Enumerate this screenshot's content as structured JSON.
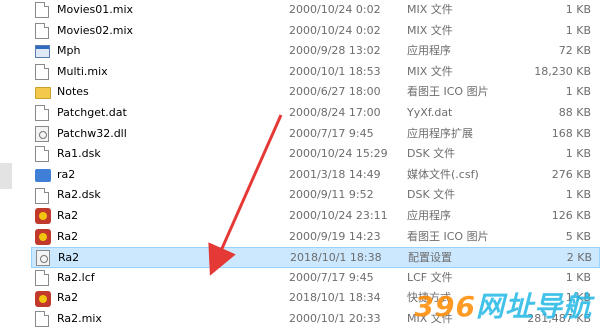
{
  "files": [
    {
      "name": "Movies01.mix",
      "date": "2000/10/24 0:02",
      "type": "MIX 文件",
      "size": "1 KB",
      "icon": "doc-icon",
      "selected": false
    },
    {
      "name": "Movies02.mix",
      "date": "2000/10/24 0:02",
      "type": "MIX 文件",
      "size": "1 KB",
      "icon": "doc-icon",
      "selected": false
    },
    {
      "name": "Mph",
      "date": "2000/9/28 13:02",
      "type": "应用程序",
      "size": "72 KB",
      "icon": "app-icon",
      "selected": false
    },
    {
      "name": "Multi.mix",
      "date": "2000/10/1 18:53",
      "type": "MIX 文件",
      "size": "18,230 KB",
      "icon": "doc-icon",
      "selected": false
    },
    {
      "name": "Notes",
      "date": "2000/6/27 18:00",
      "type": "看图王 ICO 图片",
      "size": "1 KB",
      "icon": "folder-icon",
      "selected": false
    },
    {
      "name": "Patchget.dat",
      "date": "2000/8/24 17:00",
      "type": "YyXf.dat",
      "size": "88 KB",
      "icon": "doc-icon",
      "selected": false
    },
    {
      "name": "Patchw32.dll",
      "date": "2000/7/17 9:45",
      "type": "应用程序扩展",
      "size": "168 KB",
      "icon": "gear-icon",
      "selected": false
    },
    {
      "name": "Ra1.dsk",
      "date": "2000/10/24 15:29",
      "type": "DSK 文件",
      "size": "1 KB",
      "icon": "doc-icon",
      "selected": false
    },
    {
      "name": "ra2",
      "date": "2001/3/18 14:49",
      "type": "媒体文件(.csf)",
      "size": "276 KB",
      "icon": "media-icon",
      "selected": false
    },
    {
      "name": "Ra2.dsk",
      "date": "2000/9/11 9:52",
      "type": "DSK 文件",
      "size": "1 KB",
      "icon": "doc-icon",
      "selected": false
    },
    {
      "name": "Ra2",
      "date": "2000/10/24 23:11",
      "type": "应用程序",
      "size": "126 KB",
      "icon": "game-icon",
      "selected": false
    },
    {
      "name": "Ra2",
      "date": "2000/9/19 14:23",
      "type": "看图王 ICO 图片",
      "size": "5 KB",
      "icon": "game-icon",
      "selected": false
    },
    {
      "name": "Ra2",
      "date": "2018/10/1 18:38",
      "type": "配置设置",
      "size": "2 KB",
      "icon": "gear-icon",
      "selected": true
    },
    {
      "name": "Ra2.lcf",
      "date": "2000/7/17 9:45",
      "type": "LCF 文件",
      "size": "1 KB",
      "icon": "doc-icon",
      "selected": false
    },
    {
      "name": "Ra2",
      "date": "2018/10/1 18:34",
      "type": "快捷方式",
      "size": "1 KB",
      "icon": "game-icon",
      "selected": false
    },
    {
      "name": "Ra2.mix",
      "date": "2000/10/1 20:33",
      "type": "MIX 文件",
      "size": "281,487 KB",
      "icon": "doc-icon",
      "selected": false
    }
  ],
  "watermark": {
    "part1": "396",
    "part2": "网址导航"
  }
}
